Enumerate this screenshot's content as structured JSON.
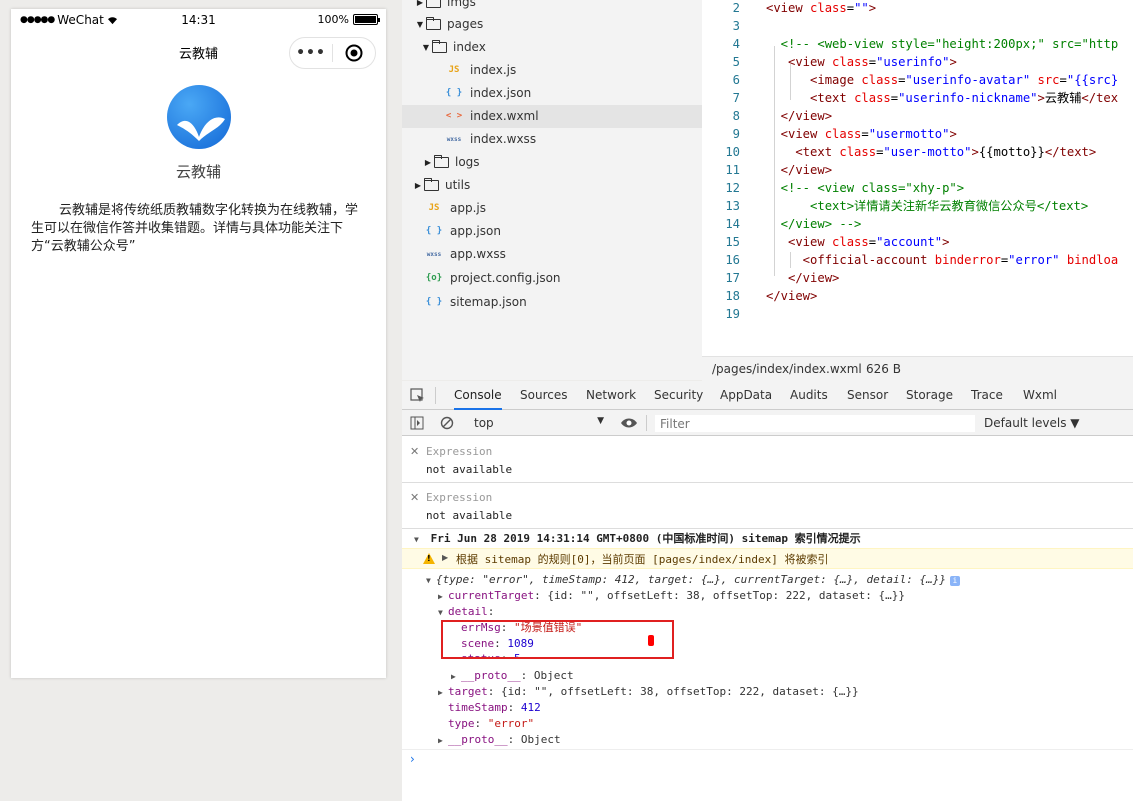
{
  "phone": {
    "status": {
      "carrier": "WeChat",
      "time": "14:31",
      "battery": "100%"
    },
    "nav_title": "云教辅",
    "more_glyph": "•••",
    "app_name": "云教辅",
    "description": "云教辅是将传统纸质教辅数字化转换为在线教辅，学生可以在微信作答并收集错题。详情与具体功能关注下方“云教辅公众号”"
  },
  "file_tree": [
    {
      "label": "imgs",
      "type": "folder"
    },
    {
      "label": "pages",
      "type": "folder"
    },
    {
      "label": "index",
      "type": "folder"
    },
    {
      "label": "index.js",
      "type": "js",
      "icon": "JS"
    },
    {
      "label": "index.json",
      "type": "json",
      "icon": "{ }"
    },
    {
      "label": "index.wxml",
      "type": "wxml",
      "icon": "< >"
    },
    {
      "label": "index.wxss",
      "type": "wxss",
      "icon": "wxss"
    },
    {
      "label": "logs",
      "type": "folder"
    },
    {
      "label": "utils",
      "type": "folder"
    },
    {
      "label": "app.js",
      "type": "js",
      "icon": "JS"
    },
    {
      "label": "app.json",
      "type": "json",
      "icon": "{ }"
    },
    {
      "label": "app.wxss",
      "type": "wxss",
      "icon": "wxss"
    },
    {
      "label": "project.config.json",
      "type": "config",
      "icon": "{o}"
    },
    {
      "label": "sitemap.json",
      "type": "json",
      "icon": "{ }"
    }
  ],
  "editor": {
    "lines": [
      {
        "n": "2",
        "tokens": [
          [
            "tag",
            "<view "
          ],
          [
            "attr",
            "class"
          ],
          [
            "txt",
            "="
          ],
          [
            "str",
            "\"\""
          ],
          [
            "tag",
            ">"
          ]
        ]
      },
      {
        "n": "3",
        "tokens": []
      },
      {
        "n": "4",
        "tokens": [
          [
            "cmt",
            "  <!-- <web-view style=\"height:200px;\" src=\"http"
          ]
        ]
      },
      {
        "n": "5",
        "tokens": [
          [
            "tag",
            "   <view "
          ],
          [
            "attr",
            "class"
          ],
          [
            "txt",
            "="
          ],
          [
            "str",
            "\"userinfo\""
          ],
          [
            "tag",
            ">"
          ]
        ]
      },
      {
        "n": "6",
        "tokens": [
          [
            "tag",
            "      <image "
          ],
          [
            "attr",
            "class"
          ],
          [
            "txt",
            "="
          ],
          [
            "str",
            "\"userinfo-avatar\" "
          ],
          [
            "attr",
            "src"
          ],
          [
            "txt",
            "="
          ],
          [
            "str",
            "\"{{src}"
          ]
        ]
      },
      {
        "n": "7",
        "tokens": [
          [
            "tag",
            "      <text "
          ],
          [
            "attr",
            "class"
          ],
          [
            "txt",
            "="
          ],
          [
            "str",
            "\"userinfo-nickname\""
          ],
          [
            "tag",
            ">"
          ],
          [
            "txt",
            "云教辅"
          ],
          [
            "tag",
            "</tex"
          ]
        ]
      },
      {
        "n": "8",
        "tokens": [
          [
            "tag",
            "  </view>"
          ]
        ]
      },
      {
        "n": "9",
        "tokens": [
          [
            "tag",
            "  <view "
          ],
          [
            "attr",
            "class"
          ],
          [
            "txt",
            "="
          ],
          [
            "str",
            "\"usermotto\""
          ],
          [
            "tag",
            ">"
          ]
        ]
      },
      {
        "n": "10",
        "tokens": [
          [
            "tag",
            "    <text "
          ],
          [
            "attr",
            "class"
          ],
          [
            "txt",
            "="
          ],
          [
            "str",
            "\"user-motto\""
          ],
          [
            "tag",
            ">"
          ],
          [
            "txt",
            "{{motto}}"
          ],
          [
            "tag",
            "</text>"
          ]
        ]
      },
      {
        "n": "11",
        "tokens": [
          [
            "tag",
            "  </view>"
          ]
        ]
      },
      {
        "n": "12",
        "tokens": [
          [
            "cmt",
            "  <!-- <view class=\"xhy-p\">"
          ]
        ]
      },
      {
        "n": "13",
        "tokens": [
          [
            "cmt",
            "      <text>详情请关注新华云教育微信公众号</text>"
          ]
        ]
      },
      {
        "n": "14",
        "tokens": [
          [
            "cmt",
            "  </view> -->"
          ]
        ]
      },
      {
        "n": "15",
        "tokens": [
          [
            "tag",
            "   <view "
          ],
          [
            "attr",
            "class"
          ],
          [
            "txt",
            "="
          ],
          [
            "str",
            "\"account\""
          ],
          [
            "tag",
            ">"
          ]
        ]
      },
      {
        "n": "16",
        "tokens": [
          [
            "tag",
            "     <official-account "
          ],
          [
            "attr",
            "binderror"
          ],
          [
            "txt",
            "="
          ],
          [
            "str",
            "\"error\" "
          ],
          [
            "attr",
            "bindloa"
          ]
        ]
      },
      {
        "n": "17",
        "tokens": [
          [
            "tag",
            "   </view>"
          ]
        ]
      },
      {
        "n": "18",
        "tokens": [
          [
            "tag",
            "</view>"
          ]
        ]
      },
      {
        "n": "19",
        "tokens": []
      }
    ],
    "status_path": "/pages/index/index.wxml",
    "status_size": "626 B"
  },
  "devtools": {
    "tabs": [
      "Console",
      "Sources",
      "Network",
      "Security",
      "AppData",
      "Audits",
      "Sensor",
      "Storage",
      "Trace",
      "Wxml"
    ],
    "active_tab": "Console",
    "context": "top",
    "filter_placeholder": "Filter",
    "levels": "Default levels ▼",
    "expressions": [
      {
        "label": "Expression",
        "value": "not available"
      },
      {
        "label": "Expression",
        "value": "not available"
      }
    ],
    "log_header": "Fri Jun 28 2019 14:31:14 GMT+0800 (中国标准时间) sitemap 索引情况提示",
    "warning": "根据 sitemap 的规则[0]，当前页面 [pages/index/index] 将被索引",
    "object_summary": "{type: \"error\", timeStamp: 412, target: {…}, currentTarget: {…}, detail: {…}}",
    "current_target": "{id: \"\", offsetLeft: 38, offsetTop: 222, dataset: {…}}",
    "err_msg": "\"场景值错误\"",
    "scene": "1089",
    "status_val": "5",
    "proto_val": "Object",
    "target": "{id: \"\", offsetLeft: 38, offsetTop: 222, dataset: {…}}",
    "timestamp": "412",
    "type_val": "\"error\"",
    "prompt": "›"
  },
  "colors": {
    "accent": "#1a73e8",
    "highlight": "#e02020",
    "warning_bg": "#fffbe5"
  }
}
